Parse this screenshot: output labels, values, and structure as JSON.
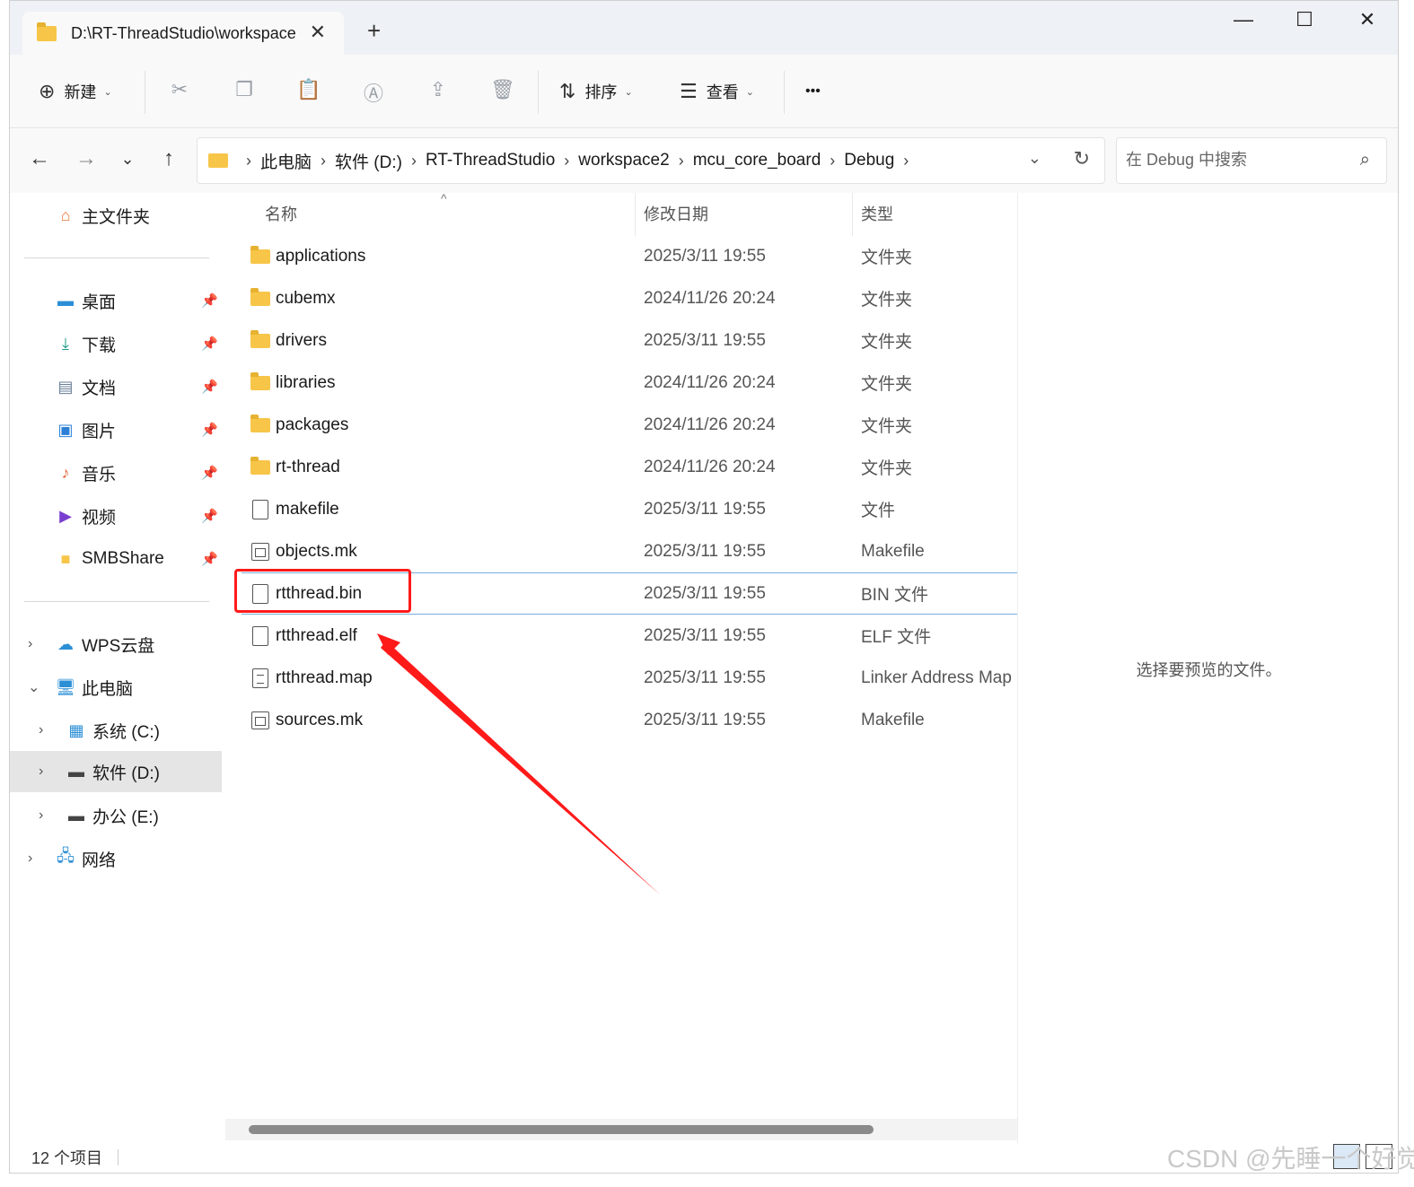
{
  "window": {
    "tab_title": "D:\\RT-ThreadStudio\\workspace2\\mcu_core_board\\Debug",
    "tab_close": "✕",
    "new_tab": "+",
    "minimize": "—",
    "maximize": "☐",
    "close": "✕"
  },
  "toolbar": {
    "new_label": "新建",
    "sort_label": "排序",
    "view_label": "查看",
    "more_label": "•••"
  },
  "address": {
    "crumbs": [
      "此电脑",
      "软件 (D:)",
      "RT-ThreadStudio",
      "workspace2",
      "mcu_core_board",
      "Debug"
    ],
    "search_placeholder": "在 Debug 中搜索"
  },
  "sidebar": {
    "home": "主文件夹",
    "quick": [
      {
        "label": "桌面",
        "icon": "desktop-icon"
      },
      {
        "label": "下载",
        "icon": "download-icon"
      },
      {
        "label": "文档",
        "icon": "document-icon"
      },
      {
        "label": "图片",
        "icon": "pictures-icon"
      },
      {
        "label": "音乐",
        "icon": "music-icon"
      },
      {
        "label": "视频",
        "icon": "video-icon"
      },
      {
        "label": "SMBShare",
        "icon": "folder-icon"
      }
    ],
    "wps": "WPS云盘",
    "this_pc": "此电脑",
    "drives": [
      "系统 (C:)",
      "软件 (D:)",
      "办公 (E:)"
    ],
    "network": "网络"
  },
  "columns": {
    "name": "名称",
    "date": "修改日期",
    "type": "类型"
  },
  "files": [
    {
      "name": "applications",
      "date": "2025/3/11 19:55",
      "type": "文件夹",
      "kind": "folder"
    },
    {
      "name": "cubemx",
      "date": "2024/11/26 20:24",
      "type": "文件夹",
      "kind": "folder"
    },
    {
      "name": "drivers",
      "date": "2025/3/11 19:55",
      "type": "文件夹",
      "kind": "folder"
    },
    {
      "name": "libraries",
      "date": "2024/11/26 20:24",
      "type": "文件夹",
      "kind": "folder"
    },
    {
      "name": "packages",
      "date": "2024/11/26 20:24",
      "type": "文件夹",
      "kind": "folder"
    },
    {
      "name": "rt-thread",
      "date": "2024/11/26 20:24",
      "type": "文件夹",
      "kind": "folder"
    },
    {
      "name": "makefile",
      "date": "2025/3/11 19:55",
      "type": "文件",
      "kind": "file"
    },
    {
      "name": "objects.mk",
      "date": "2025/3/11 19:55",
      "type": "Makefile",
      "kind": "mk"
    },
    {
      "name": "rtthread.bin",
      "date": "2025/3/11 19:55",
      "type": "BIN 文件",
      "kind": "file"
    },
    {
      "name": "rtthread.elf",
      "date": "2025/3/11 19:55",
      "type": "ELF 文件",
      "kind": "file"
    },
    {
      "name": "rtthread.map",
      "date": "2025/3/11 19:55",
      "type": "Linker Address Map",
      "kind": "map"
    },
    {
      "name": "sources.mk",
      "date": "2025/3/11 19:55",
      "type": "Makefile",
      "kind": "mk"
    }
  ],
  "preview": {
    "text": "选择要预览的文件。"
  },
  "status": {
    "count": "12 个项目"
  },
  "watermark": "CSDN @先睡一个好觉",
  "colors": {
    "annotation": "#ff1a1a",
    "folder": "#f7c548",
    "selection_border": "#7aaedf"
  }
}
